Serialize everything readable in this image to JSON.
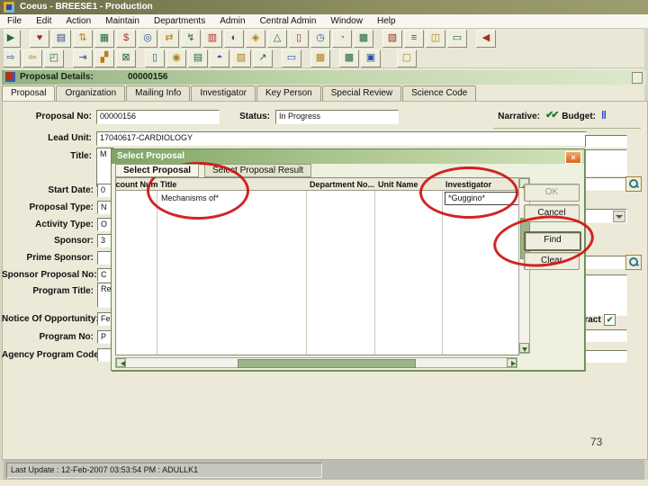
{
  "app": {
    "title": "Coeus  -  BREESE1  -  Production",
    "status_bar": "Last Update : 12-Feb-2007 03:53:54 PM : ADULLK1",
    "page_number": "73"
  },
  "menu": {
    "items": [
      "File",
      "Edit",
      "Action",
      "Maintain",
      "Departments",
      "Admin",
      "Central Admin",
      "Window",
      "Help"
    ]
  },
  "toolbar_row1": {
    "icons": [
      {
        "name": "select-icon",
        "glyph": "▶"
      },
      {
        "name": "favorites-icon",
        "glyph": "♥"
      },
      {
        "name": "new-window-icon",
        "glyph": "▤"
      },
      {
        "name": "sort-icon",
        "glyph": "⇅"
      },
      {
        "name": "catalog-icon",
        "glyph": "▦"
      },
      {
        "name": "money-bag-icon",
        "glyph": "$"
      },
      {
        "name": "binoculars-icon",
        "glyph": "◎"
      },
      {
        "name": "transfer-icon",
        "glyph": "⇄"
      },
      {
        "name": "run-icon",
        "glyph": "↯"
      },
      {
        "name": "copy-icon",
        "glyph": "▥"
      },
      {
        "name": "person-search-icon",
        "glyph": "◐"
      },
      {
        "name": "people-icon",
        "glyph": "◈"
      },
      {
        "name": "scales-icon",
        "glyph": "△"
      },
      {
        "name": "pause-icon",
        "glyph": "▯"
      },
      {
        "name": "clock-icon",
        "glyph": "◷"
      },
      {
        "name": "chart-icon",
        "glyph": "◔"
      },
      {
        "name": "printer-icon",
        "glyph": "▩"
      },
      {
        "name": "keyboard-icon",
        "glyph": "▧"
      },
      {
        "name": "list-icon",
        "glyph": "≡"
      },
      {
        "name": "columns-icon",
        "glyph": "◫"
      },
      {
        "name": "form-icon",
        "glyph": "▭"
      },
      {
        "name": "exit-icon",
        "glyph": "◀"
      }
    ]
  },
  "toolbar_row2": {
    "icons": [
      {
        "name": "next-icon",
        "glyph": "⇨"
      },
      {
        "name": "previous-icon",
        "glyph": "⇦"
      },
      {
        "name": "resize-icon",
        "glyph": "◰"
      },
      {
        "name": "export-icon",
        "glyph": "⇥"
      },
      {
        "name": "link-icon",
        "glyph": "▞"
      },
      {
        "name": "mail-icon",
        "glyph": "⊠"
      },
      {
        "name": "door-icon",
        "glyph": "▯"
      },
      {
        "name": "coins-icon",
        "glyph": "◉"
      },
      {
        "name": "briefcase-icon",
        "glyph": "▤"
      },
      {
        "name": "apple-icon",
        "glyph": "◓"
      },
      {
        "name": "tree-icon",
        "glyph": "▨"
      },
      {
        "name": "signature-icon",
        "glyph": "↗"
      },
      {
        "name": "notepad-icon",
        "glyph": "▭"
      },
      {
        "name": "calculator-icon",
        "glyph": "▦"
      },
      {
        "name": "print-icon",
        "glyph": "▩"
      },
      {
        "name": "save-icon",
        "glyph": "▣"
      },
      {
        "name": "memo-icon",
        "glyph": "▢"
      }
    ]
  },
  "proposal": {
    "window_title_label": "Proposal Details:",
    "window_title_number": "00000156",
    "tabs": [
      "Proposal",
      "Organization",
      "Mailing Info",
      "Investigator",
      "Key Person",
      "Special Review",
      "Science Code"
    ],
    "active_tab": "Proposal",
    "proposal_no_label": "Proposal No:",
    "proposal_no": "00000156",
    "status_label": "Status:",
    "status": "In Progress",
    "narrative_label": "Narrative:",
    "narrative_check": "✔✔",
    "budget_label": "Budget:",
    "budget_icon": "‖",
    "lead_unit_label": "Lead Unit:",
    "lead_unit": "17040617-CARDIOLOGY",
    "title_label": "Title:",
    "title_fragment": "M",
    "rows": [
      {
        "label": "Start Date:",
        "fragment": "0"
      },
      {
        "label": "Proposal Type:",
        "fragment": "N"
      },
      {
        "label": "Activity Type:",
        "fragment": "O"
      },
      {
        "label": "Sponsor:",
        "fragment": "3"
      },
      {
        "label": "Prime Sponsor:",
        "fragment": ""
      },
      {
        "label": "Sponsor Proposal No:",
        "fragment": "C"
      },
      {
        "label": "Program Title:",
        "fragment": "Re"
      },
      {
        "label": "Notice Of Opportunity:",
        "fragment": "Fe"
      },
      {
        "label": "Program No:",
        "fragment": "P"
      },
      {
        "label": "Agency Program Code:",
        "fragment": ""
      }
    ],
    "contract_fragment": "tract",
    "contract_check": "✔"
  },
  "dialog": {
    "title": "Select Proposal",
    "close_glyph": "×",
    "tabs": [
      "Select Proposal",
      "Select Proposal Result"
    ],
    "active_tab": "Select Proposal",
    "columns": [
      "Account Number",
      "Title",
      "Department No...",
      "Unit Name",
      "Investigator"
    ],
    "result_row": {
      "title": "Mechanisms of*",
      "investigator": "*Guggino*"
    },
    "buttons": {
      "ok": "OK",
      "cancel": "Cancel",
      "find": "Find",
      "clear": "Clear"
    }
  },
  "colors": {
    "annotation_red": "#cf1010",
    "app_titlebar_olive": "#8f8f63",
    "dialog_titlebar_green": "#7fa465",
    "narrative_check_green": "#1f7a2a",
    "budget_bars_blue": "#2244cc",
    "scroll_thumb_green": "#9cb488"
  }
}
